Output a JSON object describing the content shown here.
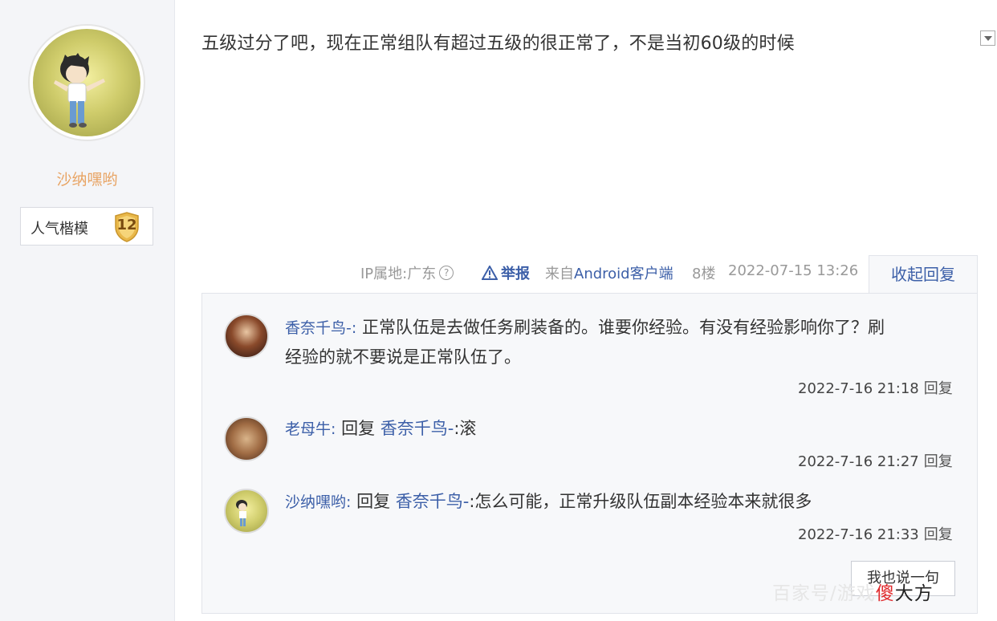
{
  "sidebar": {
    "username": "沙纳嘿哟",
    "badge_title": "人气楷模",
    "badge_level": "12"
  },
  "post": {
    "content": "五级过分了吧，现在正常组队有超过五级的很正常了，不是当初60级的时候",
    "meta": {
      "ip": "IP属地:广东",
      "report": "举报",
      "from_prefix": "来自",
      "from_client": "Android客户端",
      "floor": "8楼",
      "time": "2022-07-15 13:26"
    },
    "collapse_label": "收起回复"
  },
  "replies": [
    {
      "user": "香奈千鸟-:",
      "text_line1": "正常队伍是去做任务刷装备的。谁要你经验。有没有经验影响你了？刷",
      "text_line2": "经验的就不要说是正常队伍了。",
      "time": "2022-7-16 21:18",
      "reply_label": "回复"
    },
    {
      "user": "老母牛:",
      "reply_word": "回复",
      "target": "香奈千鸟-",
      "text": ":滚",
      "time": "2022-7-16 21:27",
      "reply_label": "回复"
    },
    {
      "user": "沙纳嘿哟:",
      "reply_word": "回复",
      "target": "香奈千鸟-",
      "text": ":怎么可能，正常升级队伍副本经验本来就很多",
      "time": "2022-7-16 21:33",
      "reply_label": "回复"
    }
  ],
  "say_button": "我也说一句",
  "watermark": {
    "light": "百家号/游戏",
    "red": "傻",
    "dark": "大方"
  },
  "colors": {
    "link": "#3c5fa8",
    "username": "#e8a464",
    "badge": "#e9b84a"
  }
}
